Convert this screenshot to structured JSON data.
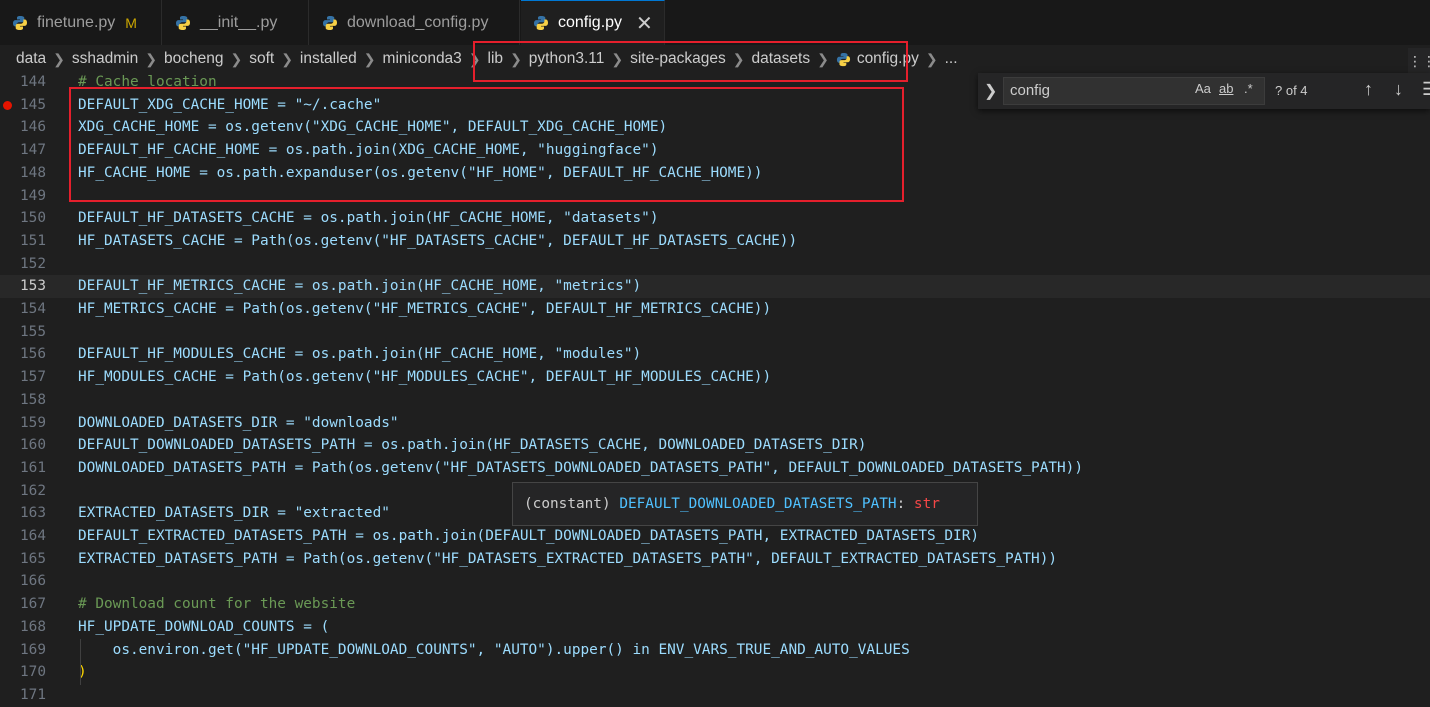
{
  "tabs": [
    {
      "label": "finetune.py",
      "modified": "M"
    },
    {
      "label": "__init__.py"
    },
    {
      "label": "download_config.py"
    },
    {
      "label": "config.py",
      "close": "✕"
    }
  ],
  "breadcrumb": [
    "data",
    "sshadmin",
    "bocheng",
    "soft",
    "installed",
    "miniconda3",
    "lib",
    "python3.11",
    "site-packages",
    "datasets",
    "config.py",
    "..."
  ],
  "find": {
    "query": "config",
    "match_case": "Aa",
    "whole_word": "ab",
    "regex": ".*",
    "count": "? of 4"
  },
  "hover": {
    "kind": "(constant)",
    "name": "DEFAULT_DOWNLOADED_DATASETS_PATH",
    "sep": ":",
    "type": "str"
  },
  "lines": [
    {
      "n": "144",
      "t": "# Cache location"
    },
    {
      "n": "145",
      "t": "DEFAULT_XDG_CACHE_HOME = \"~/.cache\""
    },
    {
      "n": "146",
      "t": "XDG_CACHE_HOME = os.getenv(\"XDG_CACHE_HOME\", DEFAULT_XDG_CACHE_HOME)"
    },
    {
      "n": "147",
      "t": "DEFAULT_HF_CACHE_HOME = os.path.join(XDG_CACHE_HOME, \"huggingface\")"
    },
    {
      "n": "148",
      "t": "HF_CACHE_HOME = os.path.expanduser(os.getenv(\"HF_HOME\", DEFAULT_HF_CACHE_HOME))"
    },
    {
      "n": "149",
      "t": ""
    },
    {
      "n": "150",
      "t": "DEFAULT_HF_DATASETS_CACHE = os.path.join(HF_CACHE_HOME, \"datasets\")"
    },
    {
      "n": "151",
      "t": "HF_DATASETS_CACHE = Path(os.getenv(\"HF_DATASETS_CACHE\", DEFAULT_HF_DATASETS_CACHE))"
    },
    {
      "n": "152",
      "t": ""
    },
    {
      "n": "153",
      "t": "DEFAULT_HF_METRICS_CACHE = os.path.join(HF_CACHE_HOME, \"metrics\")"
    },
    {
      "n": "154",
      "t": "HF_METRICS_CACHE = Path(os.getenv(\"HF_METRICS_CACHE\", DEFAULT_HF_METRICS_CACHE))"
    },
    {
      "n": "155",
      "t": ""
    },
    {
      "n": "156",
      "t": "DEFAULT_HF_MODULES_CACHE = os.path.join(HF_CACHE_HOME, \"modules\")"
    },
    {
      "n": "157",
      "t": "HF_MODULES_CACHE = Path(os.getenv(\"HF_MODULES_CACHE\", DEFAULT_HF_MODULES_CACHE))"
    },
    {
      "n": "158",
      "t": ""
    },
    {
      "n": "159",
      "t": "DOWNLOADED_DATASETS_DIR = \"downloads\""
    },
    {
      "n": "160",
      "t": "DEFAULT_DOWNLOADED_DATASETS_PATH = os.path.join(HF_DATASETS_CACHE, DOWNLOADED_DATASETS_DIR)"
    },
    {
      "n": "161",
      "t": "DOWNLOADED_DATASETS_PATH = Path(os.getenv(\"HF_DATASETS_DOWNLOADED_DATASETS_PATH\", DEFAULT_DOWNLOADED_DATASETS_PATH))"
    },
    {
      "n": "162",
      "t": ""
    },
    {
      "n": "163",
      "t": "EXTRACTED_DATASETS_DIR = \"extracted\""
    },
    {
      "n": "164",
      "t": "DEFAULT_EXTRACTED_DATASETS_PATH = os.path.join(DEFAULT_DOWNLOADED_DATASETS_PATH, EXTRACTED_DATASETS_DIR)"
    },
    {
      "n": "165",
      "t": "EXTRACTED_DATASETS_PATH = Path(os.getenv(\"HF_DATASETS_EXTRACTED_DATASETS_PATH\", DEFAULT_EXTRACTED_DATASETS_PATH))"
    },
    {
      "n": "166",
      "t": ""
    },
    {
      "n": "167",
      "t": "# Download count for the website"
    },
    {
      "n": "168",
      "t": "HF_UPDATE_DOWNLOAD_COUNTS = ("
    },
    {
      "n": "169",
      "t": "    os.environ.get(\"HF_UPDATE_DOWNLOAD_COUNTS\", \"AUTO\").upper() in ENV_VARS_TRUE_AND_AUTO_VALUES"
    },
    {
      "n": "170",
      "t": ")"
    },
    {
      "n": "171",
      "t": ""
    }
  ]
}
